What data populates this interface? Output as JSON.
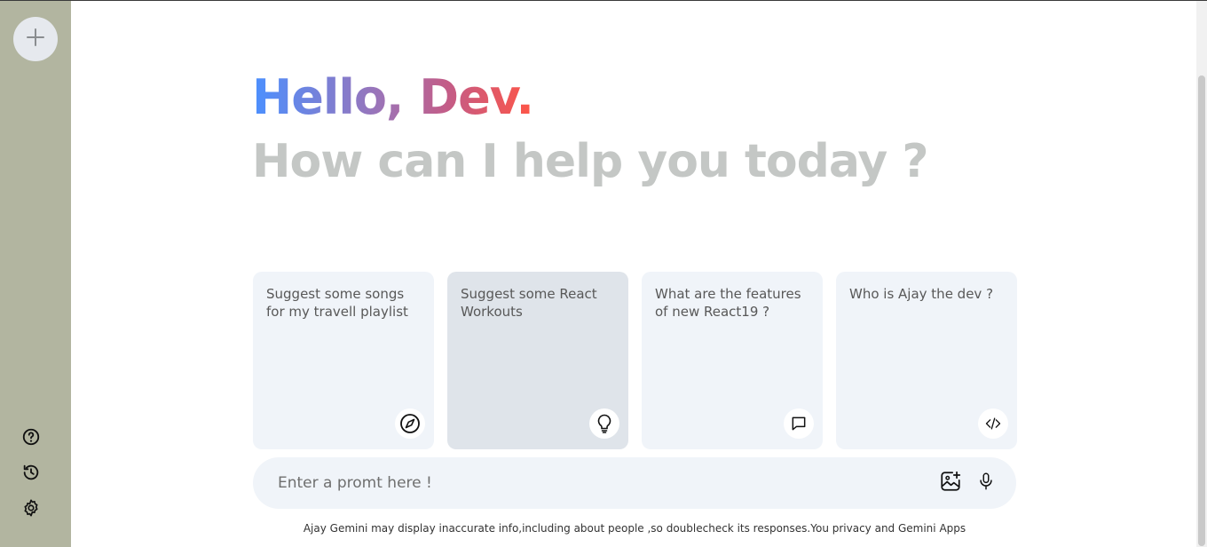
{
  "sidebar": {
    "new_chat_icon": "plus-icon",
    "bottom_icons": [
      "help-icon",
      "history-icon",
      "settings-icon"
    ]
  },
  "greeting": {
    "hello": "Hello, Dev.",
    "subtitle": "How can I help you today ?",
    "gradient_colors": [
      "#4b90ff",
      "#ff5546"
    ]
  },
  "cards": [
    {
      "text": "Suggest some songs for my travell playlist",
      "icon": "compass-icon"
    },
    {
      "text": "Suggest some React Workouts",
      "icon": "bulb-icon"
    },
    {
      "text": "What are the features of new React19 ?",
      "icon": "message-icon"
    },
    {
      "text": "Who is Ajay the dev ?",
      "icon": "code-icon"
    }
  ],
  "prompt": {
    "placeholder": "Enter a promt here !",
    "value": ""
  },
  "disclaimer": "Ajay Gemini may display inaccurate info,including about people ,so doublecheck its responses.You privacy and Gemini Apps"
}
